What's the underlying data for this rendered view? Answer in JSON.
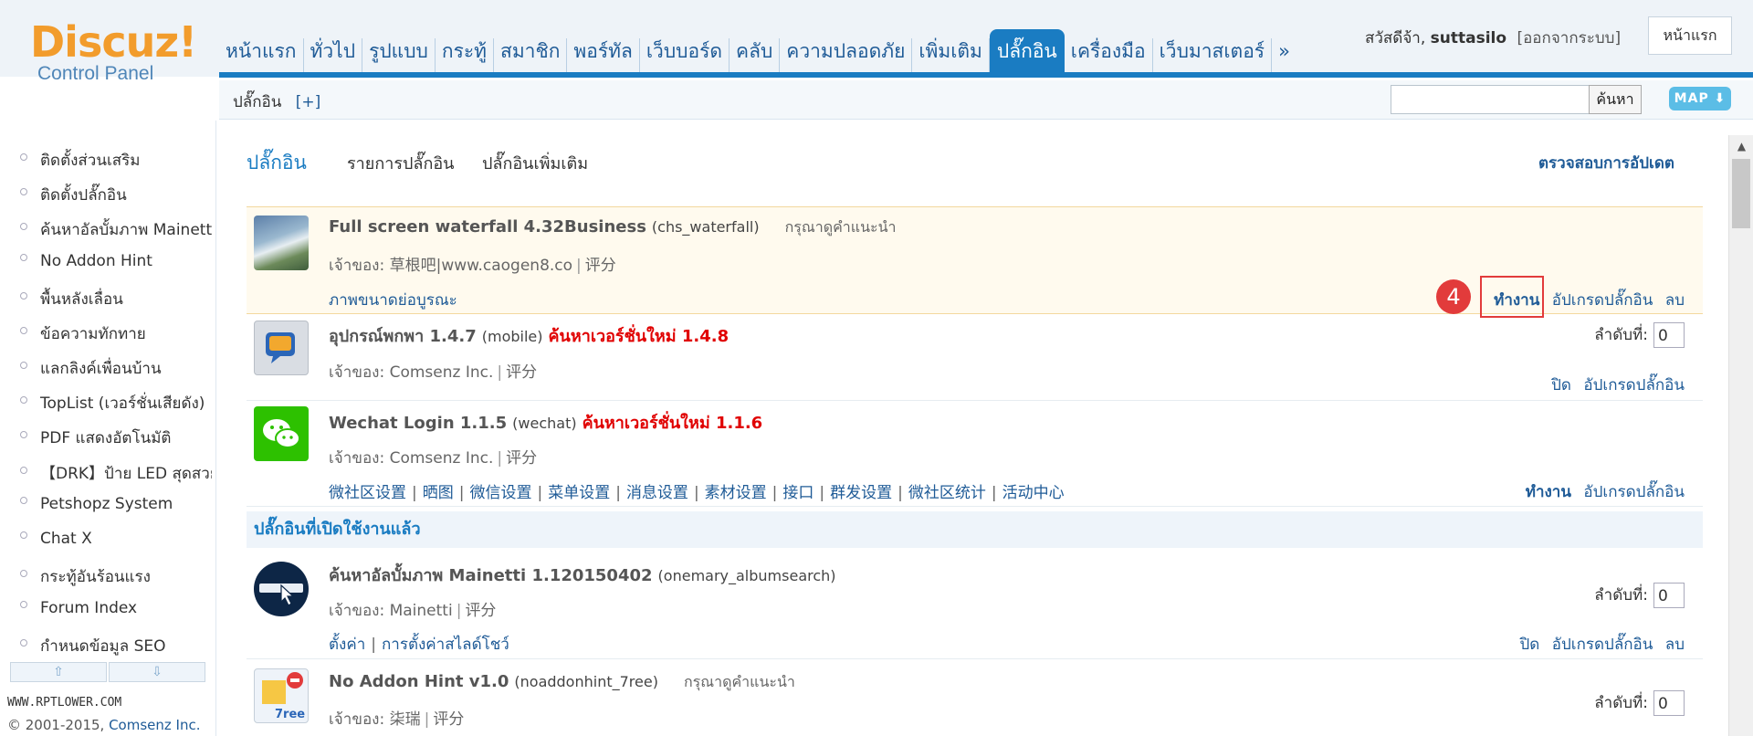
{
  "logo": {
    "main": "Discuz!",
    "sub": "Control Panel"
  },
  "nav": {
    "tabs": [
      {
        "label": "หน้าแรก"
      },
      {
        "label": "ทั่วไป"
      },
      {
        "label": "รูปแบบ"
      },
      {
        "label": "กระทู้"
      },
      {
        "label": "สมาชิก"
      },
      {
        "label": "พอร์ทัล"
      },
      {
        "label": "เว็บบอร์ด"
      },
      {
        "label": "คลับ"
      },
      {
        "label": "ความปลอดภัย"
      },
      {
        "label": "เพิ่มเติม"
      },
      {
        "label": "ปลั๊กอิน",
        "active": true
      },
      {
        "label": "เครื่องมือ"
      },
      {
        "label": "เว็บมาสเตอร์"
      },
      {
        "label": "»"
      }
    ],
    "greeting": "สวัสดีจ้า,",
    "username": "suttasilo",
    "logout": "[ออกจากระบบ]",
    "home_button": "หน้าแรก"
  },
  "subheader": {
    "title": "ปลั๊กอิน",
    "add": "[+]",
    "search_value": "",
    "search_button": "ค้นหา",
    "map_button": "MAP ⬇"
  },
  "sidebar": {
    "items": [
      {
        "label": "ติดตั้งส่วนเสริม"
      },
      {
        "label": "ติดตั้งปลั๊กอิน"
      },
      {
        "label": "ค้นหาอัลบั้มภาพ Mainetti"
      },
      {
        "label": "No Addon Hint"
      },
      {
        "label": "พื้นหลังเลื่อน"
      },
      {
        "label": "ข้อความทักทาย"
      },
      {
        "label": "แลกลิงค์เพื่อนบ้าน"
      },
      {
        "label": "TopList (เวอร์ชั่นเสียดัง)"
      },
      {
        "label": "PDF แสดงอัตโนมัติ"
      },
      {
        "label": "【DRK】ป้าย LED สุดสวย"
      },
      {
        "label": "Petshopz System"
      },
      {
        "label": "Chat X"
      },
      {
        "label": "กระทู้อันร้อนแรง"
      },
      {
        "label": "Forum Index"
      },
      {
        "label": "กำหนดข้อมูล SEO"
      }
    ],
    "scroll_up": "⇧",
    "scroll_down": "⇩",
    "watermark": "WWW.RPTLOWER.COM",
    "copyright_prefix": "© 2001-2015,",
    "copyright_link": "Comsenz Inc."
  },
  "main": {
    "title": "ปลั๊กอิน",
    "tabs": [
      {
        "label": "รายการปลั๊กอิน"
      },
      {
        "label": "ปลั๊กอินเพิ่มเติม"
      }
    ],
    "check_update": "ตรวจสอบการอัปเดต",
    "enabled_section": "ปลั๊กอินที่เปิดใช้งานแล้ว",
    "order_label": "ลำดับที่:",
    "author_label": "เจ้าของ:",
    "rate_label": "评分"
  },
  "plugins": [
    {
      "name": "Full screen waterfall 4.32Business",
      "id": "(chs_waterfall)",
      "hint": "กรุณาดูคำแนะนำ",
      "author": "草根吧|www.caogen8.co",
      "links": [
        "ภาพขนาดย่อบูรณะ"
      ],
      "actions": [
        "ทำงาน",
        "อัปเกรดปลั๊กอิน",
        "ลบ"
      ]
    },
    {
      "name": "อุปกรณ์พกพา 1.4.7",
      "id": "(mobile)",
      "new_version": "ค้นหาเวอร์ชั่นใหม่ 1.4.8",
      "author": "Comsenz Inc.",
      "order": "0",
      "actions": [
        "ปิด",
        "อัปเกรดปลั๊กอิน"
      ]
    },
    {
      "name": "Wechat Login 1.1.5",
      "id": "(wechat)",
      "new_version": "ค้นหาเวอร์ชั่นใหม่ 1.1.6",
      "author": "Comsenz Inc.",
      "links": [
        "微社区设置",
        "晒图",
        "微信设置",
        "菜单设置",
        "消息设置",
        "素材设置",
        "接口",
        "群发设置",
        "微社区统计",
        "活动中心"
      ],
      "actions": [
        "ทำงาน",
        "อัปเกรดปลั๊กอิน"
      ]
    },
    {
      "name": "ค้นหาอัลบั้มภาพ Mainetti 1.120150402",
      "id": "(onemary_albumsearch)",
      "author": "Mainetti",
      "order": "0",
      "links": [
        "ตั้งค่า",
        "การตั้งค่าสไลด์โชว์"
      ],
      "actions": [
        "ปิด",
        "อัปเกรดปลั๊กอิน",
        "ลบ"
      ]
    },
    {
      "name": "No Addon Hint v1.0",
      "id": "(noaddonhint_7ree)",
      "hint": "กรุณาดูคำแนะนำ",
      "author": "柒瑞",
      "order": "0",
      "thumb_caption": "7ree"
    }
  ],
  "annotation": {
    "step": "4"
  },
  "colors": {
    "accent": "#1a7cc2",
    "link": "#1f5b97",
    "new_version": "#e00000",
    "highlight": "#e23b3b"
  }
}
